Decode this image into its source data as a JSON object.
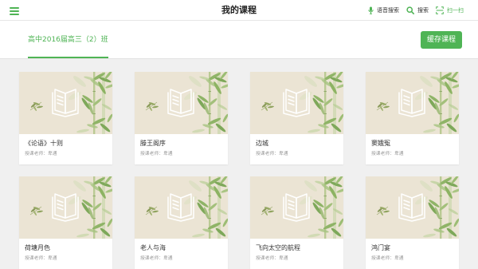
{
  "header": {
    "menu_icon": "hamburger-menu-icon",
    "title": "我的课程",
    "actions": [
      {
        "icon": "microphone-icon",
        "label": "语音搜索"
      },
      {
        "icon": "search-icon",
        "label": "搜索"
      },
      {
        "icon": "scan-icon",
        "label": "扫一扫"
      }
    ]
  },
  "tabs": [
    {
      "label": "高中2016届高三（2）班",
      "active": true
    }
  ],
  "cache_button": {
    "label": "缓存课程"
  },
  "courses": [
    {
      "title": "《论语》十则",
      "teacher": "授课老师：卑通",
      "cover_icon": "book-icon"
    },
    {
      "title": "滕王阁序",
      "teacher": "授课老师：卑通",
      "cover_icon": "book-icon"
    },
    {
      "title": "边城",
      "teacher": "授课老师：卑通",
      "cover_icon": "book-icon"
    },
    {
      "title": "窦娥冤",
      "teacher": "授课老师：卑通",
      "cover_icon": "book-icon"
    },
    {
      "title": "荷塘月色",
      "teacher": "授课老师：卑通",
      "cover_icon": "book-icon"
    },
    {
      "title": "老人与海",
      "teacher": "授课老师：卑通",
      "cover_icon": "book-icon"
    },
    {
      "title": "飞向太空的航程",
      "teacher": "授课老师：卑通",
      "cover_icon": "book-icon"
    },
    {
      "title": "鸿门宴",
      "teacher": "授课老师：卑通",
      "cover_icon": "book-icon"
    }
  ],
  "colors": {
    "accent": "#4fb455",
    "cover_background": "#ebe4d4",
    "page_background": "#f0f0f0"
  }
}
